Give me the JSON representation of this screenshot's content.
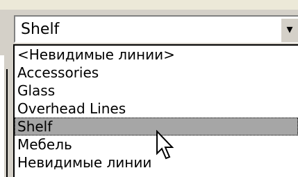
{
  "combo": {
    "value": "Shelf",
    "dropdown_icon": "chevron-down-icon"
  },
  "list": {
    "items": [
      {
        "label": "<Невидимые линии>"
      },
      {
        "label": "Accessories"
      },
      {
        "label": "Glass"
      },
      {
        "label": "Overhead Lines"
      },
      {
        "label": "Shelf"
      },
      {
        "label": "Мебель"
      },
      {
        "label": "Невидимые линии"
      }
    ],
    "selected_index": 4
  },
  "cursor_icon": "arrow-cursor-icon",
  "colors": {
    "selection": "#a6a6a6",
    "panel": "#d4d0c8"
  }
}
